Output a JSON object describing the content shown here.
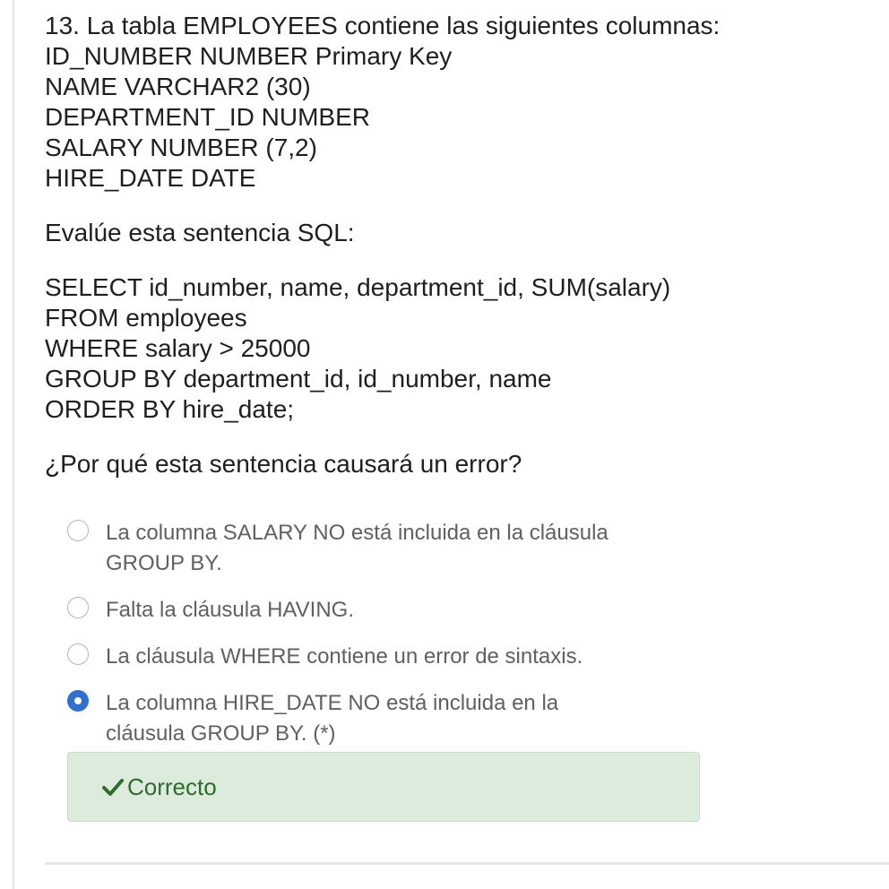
{
  "question": {
    "stem_lines": [
      "13. La tabla EMPLOYEES contiene las siguientes columnas:",
      "ID_NUMBER NUMBER Primary Key",
      "NAME VARCHAR2 (30)",
      "DEPARTMENT_ID NUMBER",
      "SALARY NUMBER (7,2)",
      "HIRE_DATE DATE"
    ],
    "prompt": "Evalúe esta sentencia SQL:",
    "sql_lines": [
      "SELECT id_number, name, department_id, SUM(salary)",
      "FROM employees",
      "WHERE salary > 25000",
      "GROUP BY department_id, id_number, name",
      "ORDER BY hire_date;"
    ],
    "ask": "¿Por qué esta sentencia causará un error?"
  },
  "options": [
    {
      "line1": "La columna SALARY NO está incluida en la cláusula",
      "line2": "GROUP BY.",
      "checked": false
    },
    {
      "line1": "Falta la cláusula HAVING.",
      "line2": "",
      "checked": false
    },
    {
      "line1": "La cláusula WHERE contiene un error de sintaxis.",
      "line2": "",
      "checked": false
    },
    {
      "line1": "La columna HIRE_DATE NO está incluida en la",
      "line2": "cláusula GROUP BY. (*)",
      "checked": true
    }
  ],
  "feedback": {
    "icon": "checkmark-icon",
    "text": "Correcto",
    "color": "#2e6b2e",
    "background": "#dcebdc"
  },
  "colors": {
    "radio_selected": "#2f6fd0",
    "option_text": "#606060"
  }
}
